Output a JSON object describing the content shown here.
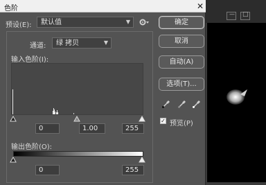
{
  "background_window": {
    "minimize_label": "—",
    "maximize_label": "□"
  },
  "dialog": {
    "title": "色阶",
    "close_label": "✕",
    "preset": {
      "label": "预设(E):",
      "value": "默认值"
    },
    "channel": {
      "label": "通道:",
      "value": "绿 拷贝"
    },
    "input_levels": {
      "label": "输入色阶(I):",
      "black": "0",
      "gamma": "1.00",
      "white": "255"
    },
    "output_levels": {
      "label": "输出色阶(O):",
      "black": "0",
      "white": "255"
    },
    "buttons": {
      "ok": "确定",
      "cancel": "取消",
      "auto": "自动(A)",
      "options": "选项(T)..."
    },
    "preview": {
      "label": "预览(P)",
      "checked": true
    }
  },
  "colors": {
    "dialog_bg": "#535353",
    "histogram_bg": "#474747"
  }
}
